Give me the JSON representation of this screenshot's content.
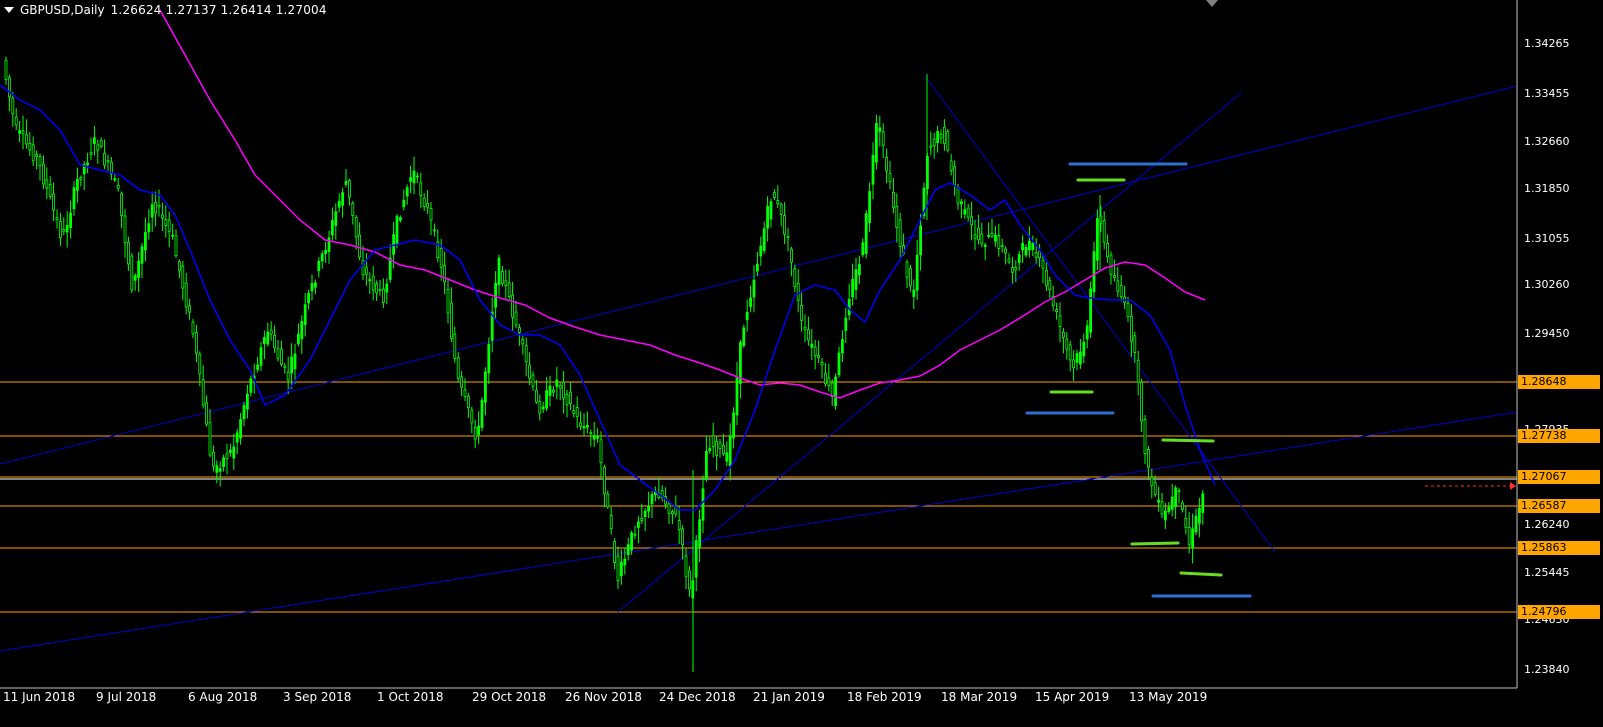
{
  "header": {
    "symbol_tf": "GBPUSD,Daily",
    "ohlc": "1.26624 1.27137 1.26414 1.27004"
  },
  "colors": {
    "background": "#000000",
    "candle": "#00ff00",
    "ma_fast": "#0000ff",
    "ma_slow": "#ff00ff",
    "hline": "#ffa500",
    "trendline": "#0000cd",
    "marker_green": "#66dd22",
    "marker_blue": "#2f6fd0"
  },
  "y_axis_ticks": [
    "1.34265",
    "1.33455",
    "1.32660",
    "1.31850",
    "1.31055",
    "1.30260",
    "1.29450",
    "1.27935",
    "1.26240",
    "1.25445",
    "1.24630",
    "1.23840"
  ],
  "price_tags": [
    "1.28648",
    "1.27738",
    "1.27067",
    "1.26587",
    "1.25863",
    "1.24796"
  ],
  "x_axis_ticks": [
    "11 Jun 2018",
    "9 Jul 2018",
    "6 Aug 2018",
    "3 Sep 2018",
    "1 Oct 2018",
    "29 Oct 2018",
    "26 Nov 2018",
    "24 Dec 2018",
    "21 Jan 2019",
    "18 Feb 2019",
    "18 Mar 2019",
    "15 Apr 2019",
    "13 May 2019"
  ]
}
